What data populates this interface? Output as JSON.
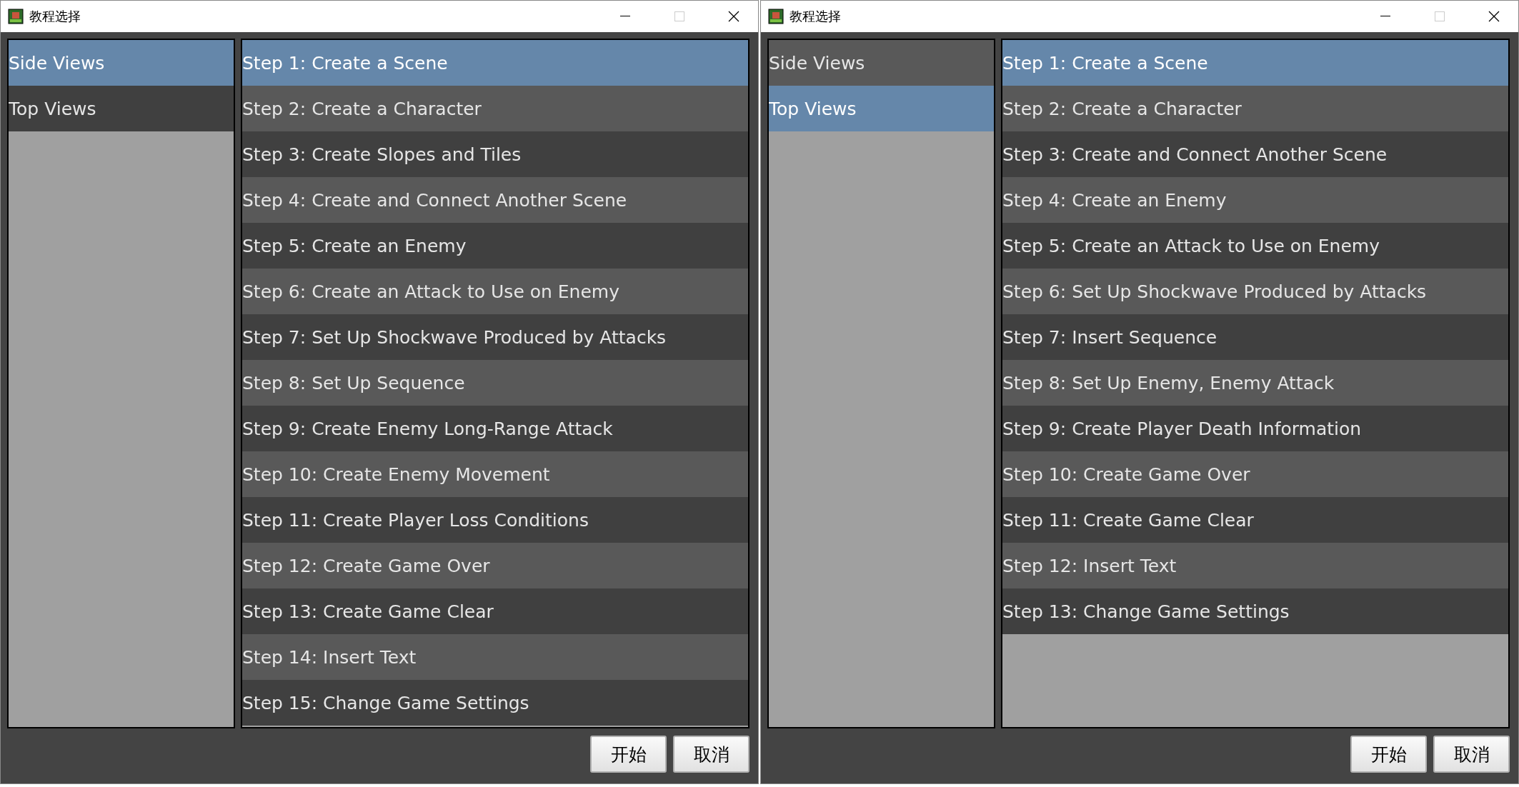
{
  "windows": [
    {
      "title": "教程选择",
      "categories": [
        {
          "label": "Side Views",
          "selected": true
        },
        {
          "label": "Top Views",
          "selected": false
        }
      ],
      "steps": [
        {
          "label": "Step 1: Create a Scene",
          "selected": true
        },
        {
          "label": "Step 2: Create a Character",
          "selected": false
        },
        {
          "label": "Step 3: Create Slopes and Tiles",
          "selected": false
        },
        {
          "label": "Step 4: Create and Connect Another Scene",
          "selected": false
        },
        {
          "label": "Step 5: Create an Enemy",
          "selected": false
        },
        {
          "label": "Step 6: Create an Attack to Use on Enemy",
          "selected": false
        },
        {
          "label": "Step 7: Set Up Shockwave Produced by Attacks",
          "selected": false
        },
        {
          "label": "Step 8: Set Up Sequence",
          "selected": false
        },
        {
          "label": "Step 9: Create Enemy Long-Range Attack",
          "selected": false
        },
        {
          "label": "Step 10: Create Enemy Movement",
          "selected": false
        },
        {
          "label": "Step 11: Create Player Loss Conditions",
          "selected": false
        },
        {
          "label": "Step 12: Create Game Over",
          "selected": false
        },
        {
          "label": "Step 13: Create Game Clear",
          "selected": false
        },
        {
          "label": "Step 14: Insert Text",
          "selected": false
        },
        {
          "label": "Step 15: Change Game Settings",
          "selected": false
        }
      ],
      "buttons": [
        "开始",
        "取消"
      ]
    },
    {
      "title": "教程选择",
      "categories": [
        {
          "label": "Side Views",
          "selected": false
        },
        {
          "label": "Top Views",
          "selected": true
        }
      ],
      "steps": [
        {
          "label": "Step 1: Create a Scene",
          "selected": true
        },
        {
          "label": "Step 2: Create a Character",
          "selected": false
        },
        {
          "label": "Step 3: Create and Connect Another Scene",
          "selected": false
        },
        {
          "label": "Step 4: Create an Enemy",
          "selected": false
        },
        {
          "label": "Step 5: Create an Attack to Use on Enemy",
          "selected": false
        },
        {
          "label": "Step 6: Set Up Shockwave Produced by Attacks",
          "selected": false
        },
        {
          "label": "Step 7: Insert Sequence",
          "selected": false
        },
        {
          "label": "Step 8: Set Up Enemy, Enemy Attack",
          "selected": false
        },
        {
          "label": "Step 9: Create Player Death Information",
          "selected": false
        },
        {
          "label": "Step 10: Create Game Over",
          "selected": false
        },
        {
          "label": "Step 11: Create Game Clear",
          "selected": false
        },
        {
          "label": "Step 12: Insert Text",
          "selected": false
        },
        {
          "label": "Step 13: Change Game Settings",
          "selected": false
        }
      ],
      "buttons": [
        "开始",
        "取消"
      ]
    }
  ]
}
